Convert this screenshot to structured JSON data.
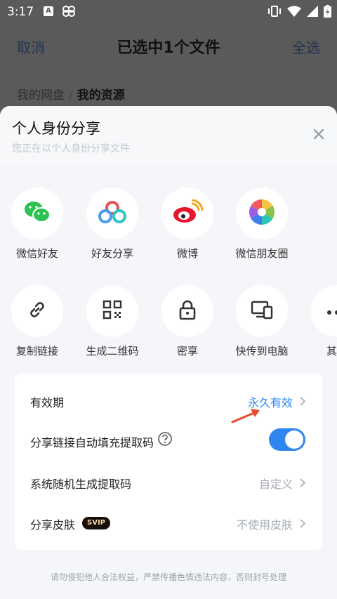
{
  "status_bar": {
    "time": "3:17",
    "notif_letter": "A"
  },
  "top_bar": {
    "cancel": "取消",
    "title": "已选中1个文件",
    "select_all": "全选"
  },
  "breadcrumb": {
    "root": "我的网盘",
    "separator": "/",
    "current": "我的资源"
  },
  "sheet": {
    "title": "个人身份分享",
    "subtitle": "您正在以个人身份分享文件",
    "row1": [
      {
        "label": "微信好友",
        "icon": "wechat-icon"
      },
      {
        "label": "好友分享",
        "icon": "friend-share-icon"
      },
      {
        "label": "微博",
        "icon": "weibo-icon"
      },
      {
        "label": "微信朋友圈",
        "icon": "moments-icon"
      }
    ],
    "row2": [
      {
        "label": "复制链接",
        "icon": "link-icon"
      },
      {
        "label": "生成二维码",
        "icon": "qrcode-icon"
      },
      {
        "label": "密享",
        "icon": "lock-icon"
      },
      {
        "label": "快传到电脑",
        "icon": "devices-icon"
      },
      {
        "label": "其他",
        "icon": "more-icon"
      }
    ],
    "settings": {
      "validity_label": "有效期",
      "validity_value": "永久有效",
      "autofill_label": "分享链接自动填充提取码",
      "autofill_on": true,
      "random_code_label": "系统随机生成提取码",
      "random_code_value": "自定义",
      "skin_label": "分享皮肤",
      "skin_badge": "SVIP",
      "skin_value": "不使用皮肤"
    },
    "footer": "请勿侵犯他人合法权益，严禁传播色情违法内容，否则封号处理"
  },
  "colors": {
    "accent": "#2f86f0",
    "annotation_arrow": "#e84a2e"
  }
}
